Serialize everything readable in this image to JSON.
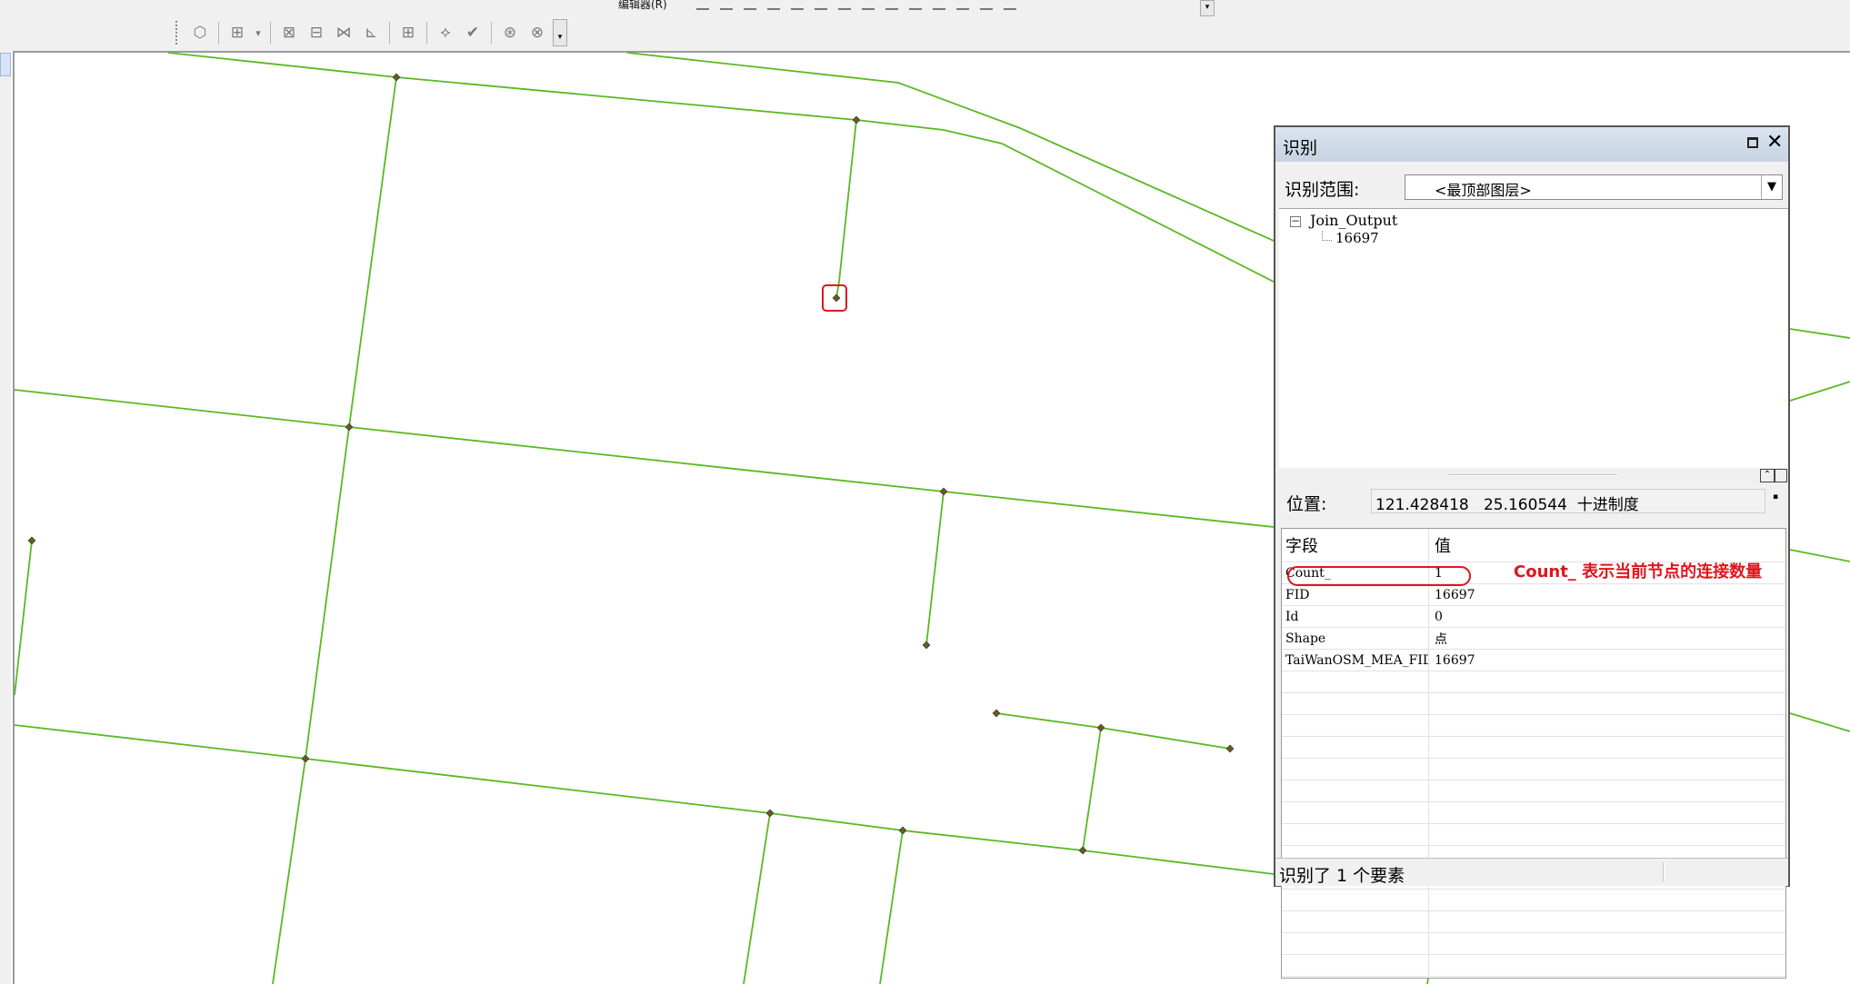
{
  "toolbar": {
    "menu_label": "编辑器(R)",
    "overflow_glyph": "▾"
  },
  "identify": {
    "title": "识别",
    "scope_label": "识别范围:",
    "scope_value": "<最顶部图层>",
    "tree": {
      "layer": "Join_Output",
      "feature": "16697"
    },
    "location_label": "位置:",
    "location_value": "121.428418   25.160544  十进制度",
    "grid": {
      "headers": [
        "字段",
        "值"
      ],
      "rows": [
        {
          "field": "Count_",
          "value": "1"
        },
        {
          "field": "FID",
          "value": "16697"
        },
        {
          "field": "Id",
          "value": "0"
        },
        {
          "field": "Shape",
          "value": "点"
        },
        {
          "field": "TaiWanOSM_MEA_FID",
          "value": "16697"
        }
      ]
    },
    "annotation": "Count_ 表示当前节点的连接数量",
    "status": "识别了 1 个要素"
  },
  "colors": {
    "road": "#5bb821",
    "node": "#6b5a1e",
    "highlight": "#e0141e"
  }
}
